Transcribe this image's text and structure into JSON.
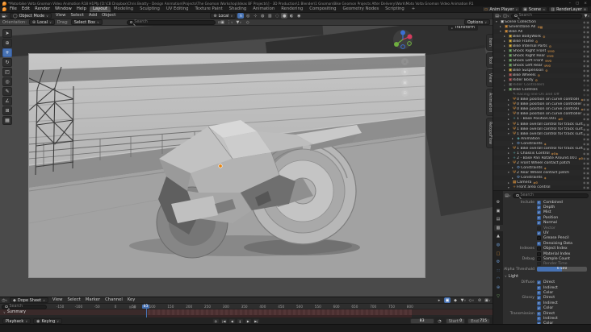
{
  "window": {
    "title": "*Motorbike Volta Gnomon Video Animation R18 H1Pfp [D:\\CB Dropbox\\Chris Beatty - Design Animation\\Projects\\The Gnomon Workshop\\Ideas BF Projects\\] - 3D Production\\1 Blender\\1 Gnomon\\Bike Gnomon Projects After Delivery\\Work\\Moto Volta Gnomon Video Animation R1",
    "controls": [
      "–",
      "▢",
      "×"
    ]
  },
  "topbar": {
    "menus": [
      "File",
      "Edit",
      "Render",
      "Window",
      "Help"
    ],
    "workspaces": [
      "Layout",
      "Modeling",
      "Sculpting",
      "UV Editing",
      "Texture Paint",
      "Shading",
      "Animation",
      "Rendering",
      "Compositing",
      "Geometry Nodes",
      "Scripting"
    ],
    "active_workspace": "Layout",
    "workspace_add": "+",
    "right": {
      "anim_player": "Anim Player",
      "scene": "Scene",
      "view_layer": "RenderLayer"
    }
  },
  "viewport_header": {
    "mode": "Object Mode",
    "menus": [
      "View",
      "Select",
      "Add",
      "Object"
    ],
    "orientation": "Local",
    "icons": [
      {
        "name": "snap-magnet-icon",
        "glyph": "∩",
        "on": true
      },
      {
        "name": "proportional-editing-icon",
        "glyph": "◎"
      },
      {
        "name": "show-gizmo-icon",
        "glyph": "⊹"
      },
      {
        "name": "show-overlays-icon",
        "glyph": "◍"
      },
      {
        "name": "xray-icon",
        "glyph": "▥"
      },
      {
        "name": "shading-wireframe-icon",
        "glyph": "◌"
      },
      {
        "name": "shading-solid-icon",
        "glyph": "●",
        "lit": true
      },
      {
        "name": "shading-material-icon",
        "glyph": "◐"
      },
      {
        "name": "shading-rendered-icon",
        "glyph": "◉"
      }
    ]
  },
  "tool_settings": {
    "orientation_label": "Orientation:",
    "orientation_value": "Local",
    "drag_label": "Drag:",
    "drag_value": "Select Box",
    "search_placeholder": "Search",
    "options_label": "Options"
  },
  "toolbar": {
    "tools": [
      {
        "name": "select-box-tool",
        "glyph": "➤"
      },
      {
        "name": "cursor-tool",
        "glyph": "⊕"
      },
      {
        "name": "move-tool",
        "glyph": "+",
        "selected": true
      },
      {
        "name": "rotate-tool",
        "glyph": "↻"
      },
      {
        "name": "scale-tool",
        "glyph": "◰"
      },
      {
        "name": "transform-tool",
        "glyph": "◎"
      },
      {
        "name": "annotate-tool",
        "glyph": "✎"
      },
      {
        "name": "measure-tool",
        "glyph": "∠"
      },
      {
        "name": "add-cube-tool",
        "glyph": "⊞"
      },
      {
        "name": "extra-tool",
        "glyph": "▦"
      }
    ]
  },
  "viewport": {
    "transform_panel_label": "Transform",
    "sidebar_tabs": [
      "Item",
      "Tool",
      "View",
      "Animation",
      "RetopoFlow"
    ],
    "nav_icons": [
      {
        "name": "zoom-icon",
        "glyph": "mag"
      },
      {
        "name": "pan-icon",
        "glyph": "❖"
      },
      {
        "name": "camera-view-icon",
        "glyph": "▣"
      },
      {
        "name": "perspective-icon",
        "glyph": "⊞"
      }
    ],
    "origin_color": "#e8830c"
  },
  "outliner": {
    "search_placeholder": "Search",
    "rows": [
      {
        "d": 0,
        "a": "v",
        "g": "▣",
        "c": "w",
        "t": "Scene Collection"
      },
      {
        "d": 1,
        "a": ">",
        "g": "▣",
        "c": "o",
        "t": "Silverstone All",
        "b": "⚙▦"
      },
      {
        "d": 1,
        "a": "v",
        "g": "▣",
        "c": "o",
        "t": "Bike All"
      },
      {
        "d": 2,
        "a": ">",
        "g": "▣",
        "c": "y",
        "t": "Bike BodyWork",
        "b": "⚙"
      },
      {
        "d": 2,
        "a": ">",
        "g": "▣",
        "c": "y",
        "t": "Bike Frame",
        "b": "⚙"
      },
      {
        "d": 2,
        "a": ">",
        "g": "▣",
        "c": "y",
        "t": "Bike Internal Parts",
        "b": "⚙"
      },
      {
        "d": 2,
        "a": ">",
        "g": "▣",
        "c": "g",
        "t": "Shock Right Front",
        "b": "ΨΨ⚙"
      },
      {
        "d": 2,
        "a": ">",
        "g": "▣",
        "c": "g",
        "t": "Shock Right Rear",
        "b": "ΨΨ⚙"
      },
      {
        "d": 2,
        "a": ">",
        "g": "▣",
        "c": "g",
        "t": "Shock Left Front",
        "b": "ΨΨ⚙"
      },
      {
        "d": 2,
        "a": ">",
        "g": "▣",
        "c": "g",
        "t": "Shock Left Rear",
        "b": "ΨΨ⚙"
      },
      {
        "d": 2,
        "a": ">",
        "g": "▣",
        "c": "y",
        "t": "Bike Suspension",
        "b": "⚙"
      },
      {
        "d": 2,
        "a": ">",
        "g": "▣",
        "c": "r",
        "t": "Bike Wheels",
        "b": "⚙"
      },
      {
        "d": 2,
        "a": ">",
        "g": "▣",
        "c": "r",
        "t": "Rider Body",
        "b": "⚙"
      },
      {
        "d": 2,
        "a": ">",
        "g": "▣",
        "c": "w",
        "t": "Rider Controllers",
        "dim": 1
      },
      {
        "d": 2,
        "a": "v",
        "g": "▣",
        "c": "g",
        "t": "Bike Controls"
      },
      {
        "d": 3,
        "a": "",
        "g": "✎",
        "c": "w",
        "t": "Racing line On and Off",
        "dim": 1
      },
      {
        "d": 3,
        "a": ">",
        "g": "Ψ",
        "c": "o",
        "t": "0 Bike position on curve controller Front",
        "b": "◈"
      },
      {
        "d": 3,
        "a": ">",
        "g": "Ψ",
        "c": "o",
        "t": "0 Bike position on curve controller Front.001"
      },
      {
        "d": 3,
        "a": ">",
        "g": "Ψ",
        "c": "o",
        "t": "0 Bike position on curve controller Rear",
        "b": "◈"
      },
      {
        "d": 3,
        "a": ">",
        "g": "Ψ",
        "c": "o",
        "t": "0 Bike position on curve controller Rear.001"
      },
      {
        "d": 3,
        "a": ">",
        "g": "+",
        "c": "t",
        "t": "1 - Base Position.001",
        "b": "◈⚙"
      },
      {
        "d": 3,
        "a": ">",
        "g": "Ψ",
        "c": "o",
        "t": "1 Bike overall control for track surface Front"
      },
      {
        "d": 3,
        "a": ">",
        "g": "Ψ",
        "c": "o",
        "t": "1 Bike overall control for track surface Front.001"
      },
      {
        "d": 3,
        "a": "v",
        "g": "Ψ",
        "c": "o",
        "t": "1 Bike overall control for track surface Rear"
      },
      {
        "d": 4,
        "a": ">",
        "g": "◈",
        "c": "t",
        "t": "Animation"
      },
      {
        "d": 4,
        "a": ">",
        "g": "⚙",
        "c": "b",
        "t": "Constraints",
        "b": "◈"
      },
      {
        "d": 3,
        "a": ">",
        "g": "Ψ",
        "c": "o",
        "t": "1 Bike overall control for track surface Rear.001"
      },
      {
        "d": 3,
        "a": ">",
        "g": "+",
        "c": "t",
        "t": "1 Chassis Control",
        "b": "◈⚙◈"
      },
      {
        "d": 3,
        "a": ">",
        "g": "+",
        "c": "t",
        "t": "2 - Base Pan Rotate Around.001",
        "b": "◈⚙"
      },
      {
        "d": 3,
        "a": "v",
        "g": "Ψ",
        "c": "o",
        "t": "2 Front Wheel contact patch"
      },
      {
        "d": 4,
        "a": ">",
        "g": "⚙",
        "c": "b",
        "t": "Constraints",
        "b": "◈"
      },
      {
        "d": 3,
        "a": "v",
        "g": "Ψ",
        "c": "o",
        "t": "2 Rear Wheel contact patch"
      },
      {
        "d": 4,
        "a": ">",
        "g": "⚙",
        "c": "b",
        "t": "Constraints",
        "b": "◈"
      },
      {
        "d": 3,
        "a": ">",
        "g": "▦",
        "c": "o",
        "t": "Camera",
        "b": "◈⚙"
      },
      {
        "d": 3,
        "a": "v",
        "g": "+",
        "c": "o",
        "t": "Front area control"
      }
    ]
  },
  "properties": {
    "search_placeholder": "Search",
    "tabs": [
      {
        "name": "tool-tab-icon",
        "glyph": "⚙",
        "color": "#bdbdbd"
      },
      {
        "name": "render-tab-icon",
        "glyph": "▣",
        "color": "#bdbdbd"
      },
      {
        "name": "output-tab-icon",
        "glyph": "▤",
        "color": "#bdbdbd"
      },
      {
        "name": "view-layer-tab-icon",
        "glyph": "▥",
        "color": "#e8e8e8",
        "selected": true
      },
      {
        "name": "scene-tab-icon",
        "glyph": "▲",
        "color": "#bdbdbd"
      },
      {
        "name": "world-tab-icon",
        "glyph": "◍",
        "color": "#6f9fd8"
      },
      {
        "name": "object-tab-icon",
        "glyph": "□",
        "color": "#d9913c"
      },
      {
        "name": "modifiers-tab-icon",
        "glyph": "⚙",
        "color": "#6f9fd8"
      },
      {
        "name": "particles-tab-icon",
        "glyph": "∷",
        "color": "#6f9fd8"
      },
      {
        "name": "physics-tab-icon",
        "glyph": "◠",
        "color": "#6f9fd8"
      },
      {
        "name": "constraints-tab-icon",
        "glyph": "⊕",
        "color": "#6f9fd8"
      },
      {
        "name": "data-tab-icon",
        "glyph": "▽",
        "color": "#76b06a"
      }
    ],
    "include": {
      "label": "Include",
      "items": [
        {
          "t": "Combined",
          "c": 1
        },
        {
          "t": "Depth",
          "c": 1
        },
        {
          "t": "Mist",
          "c": 1
        },
        {
          "t": "Position",
          "c": 1
        },
        {
          "t": "Normal",
          "c": 1
        },
        {
          "t": "Vector",
          "c": 0,
          "dim": 1
        },
        {
          "t": "UV",
          "c": 1
        },
        {
          "t": "Grease Pencil",
          "c": 0
        },
        {
          "t": "Denoising Data",
          "c": 1
        }
      ]
    },
    "indexes": {
      "label": "Indexes",
      "items": [
        {
          "t": "Object Index",
          "c": 0
        },
        {
          "t": "Material Index",
          "c": 0
        }
      ]
    },
    "debug": {
      "label": "Debug",
      "items": [
        {
          "t": "Sample Count",
          "c": 0
        },
        {
          "t": "Render Time",
          "c": 0,
          "dim": 1
        }
      ]
    },
    "alpha_threshold": {
      "label": "Alpha Threshold",
      "value": "0.500",
      "fraction": 0.5
    },
    "light": {
      "label": "Light",
      "groups": [
        {
          "label": "Diffuse",
          "items": [
            {
              "t": "Direct",
              "c": 1
            },
            {
              "t": "Indirect",
              "c": 1
            },
            {
              "t": "Color",
              "c": 1
            }
          ]
        },
        {
          "label": "Glossy",
          "items": [
            {
              "t": "Direct",
              "c": 1
            },
            {
              "t": "Indirect",
              "c": 1
            },
            {
              "t": "Color",
              "c": 1
            }
          ]
        },
        {
          "label": "Transmission",
          "items": [
            {
              "t": "Direct",
              "c": 1
            },
            {
              "t": "Indirect",
              "c": 1
            },
            {
              "t": "Color",
              "c": 1
            }
          ]
        }
      ]
    }
  },
  "dopesheet": {
    "editor_label": "Dope Sheet",
    "menus": [
      "View",
      "Select",
      "Marker",
      "Channel",
      "Key"
    ],
    "search_placeholder": "Search",
    "ruler_ticks": [
      -150,
      -100,
      -50,
      0,
      50,
      100,
      150,
      200,
      250,
      300,
      350,
      400,
      450,
      500,
      550,
      600,
      650,
      700,
      750,
      800
    ],
    "current_frame": "83",
    "summary_label": "Summary",
    "playback": {
      "playback_label": "Playback",
      "keying_label": "Keying",
      "transport": [
        {
          "name": "sync-icon",
          "glyph": "◎"
        },
        {
          "name": "jump-to-start-button",
          "glyph": "|◀"
        },
        {
          "name": "previous-keyframe-button",
          "glyph": "◀"
        },
        {
          "name": "pause-button",
          "glyph": "‖"
        },
        {
          "name": "next-keyframe-button",
          "glyph": "▶"
        },
        {
          "name": "jump-to-end-button",
          "glyph": "▶|"
        }
      ],
      "frame": "83",
      "start_label": "Start",
      "start": "0",
      "end_label": "End",
      "end": "715"
    }
  },
  "colors": {
    "accent": "#4772b3",
    "object_orange": "#e8830c",
    "summary_red": "#4a2f30"
  }
}
